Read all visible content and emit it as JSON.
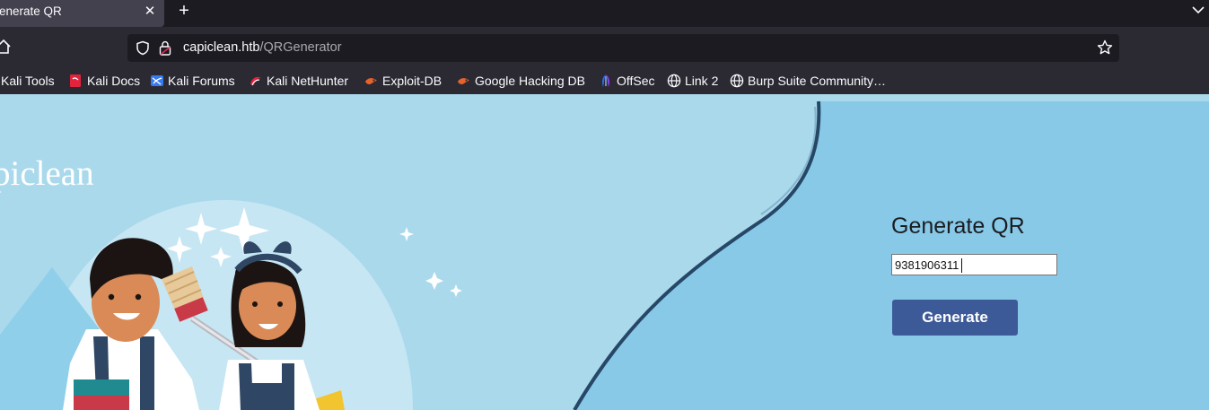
{
  "browser": {
    "tab": {
      "title": "enerate QR",
      "close_glyph": "✕"
    },
    "new_tab_glyph": "+",
    "url": {
      "host": "capiclean.htb",
      "path": "/QRGenerator"
    },
    "icons": [
      "home-icon",
      "shield-icon",
      "lock-icon",
      "star-icon",
      "chevron-down-icon",
      "close-icon",
      "plus-icon"
    ],
    "bookmarks": [
      {
        "label": "Kali Tools",
        "icon": "kali-icon"
      },
      {
        "label": "Kali Docs",
        "icon": "kali-docs-icon"
      },
      {
        "label": "Kali Forums",
        "icon": "kali-forums-icon"
      },
      {
        "label": "Kali NetHunter",
        "icon": "nethunter-icon"
      },
      {
        "label": "Exploit-DB",
        "icon": "exploit-db-icon"
      },
      {
        "label": "Google Hacking DB",
        "icon": "ghdb-icon"
      },
      {
        "label": "OffSec",
        "icon": "offsec-icon"
      },
      {
        "label": "Link 2",
        "icon": "globe-icon"
      },
      {
        "label": "Burp Suite Community…",
        "icon": "globe-icon"
      }
    ]
  },
  "page": {
    "brand": "piclean",
    "form": {
      "title": "Generate QR",
      "input_value": "9381906311",
      "button_label": "Generate"
    }
  },
  "colors": {
    "page_light_blue": "#aad9ec",
    "panel_blue": "#88c9e8",
    "button": "#3d5a98",
    "chrome_dark": "#1c1b22",
    "chrome_mid": "#2b2a33"
  }
}
